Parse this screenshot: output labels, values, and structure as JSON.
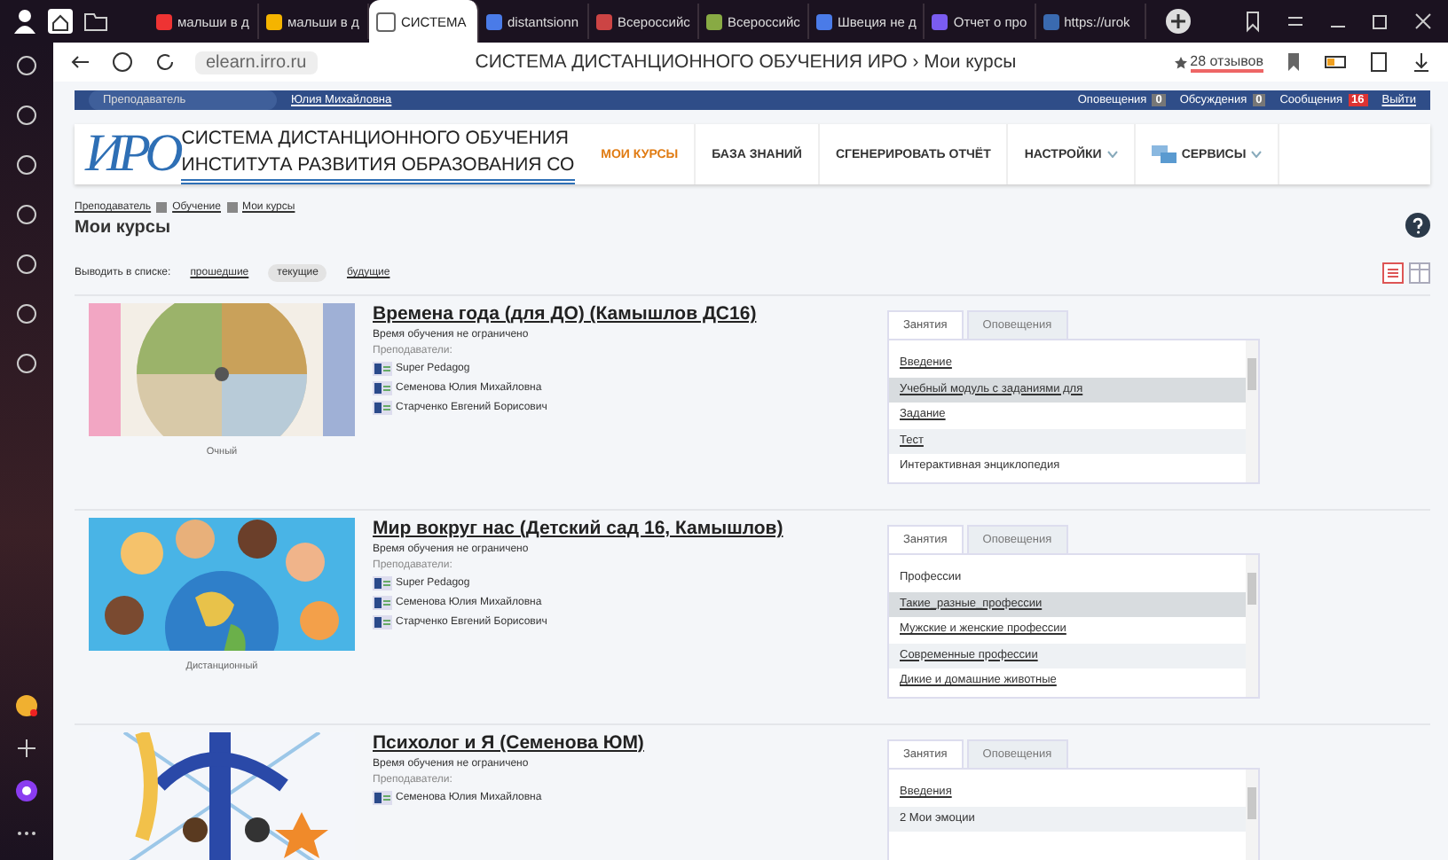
{
  "browser": {
    "tabs": [
      {
        "title": "мальши в д",
        "selected": false
      },
      {
        "title": "мальши в д",
        "selected": false
      },
      {
        "title": "СИСТЕМА",
        "selected": true
      },
      {
        "title": "distantsionn",
        "selected": false
      },
      {
        "title": "Всероссийс",
        "selected": false
      },
      {
        "title": "Всероссийс",
        "selected": false
      },
      {
        "title": "Швеция не д",
        "selected": false
      },
      {
        "title": "Отчет о про",
        "selected": false
      },
      {
        "title": "https://urok",
        "selected": false
      }
    ],
    "address": "elearn.irro.ru",
    "page_title": "СИСТЕМА ДИСТАНЦИОННОГО ОБУЧЕНИЯ ИРО › Мои курсы",
    "reviews": "28 отзывов"
  },
  "user_bar": {
    "role": "Преподаватель",
    "user": "Юлия Михайловна",
    "counters": [
      {
        "label": "Оповещения",
        "count": "0",
        "alert": false
      },
      {
        "label": "Обсуждения",
        "count": "0",
        "alert": false
      },
      {
        "label": "Сообщения",
        "count": "16",
        "alert": true
      }
    ],
    "logout": "Выйти"
  },
  "header": {
    "logo_mark": "ИРО",
    "logo_lines": [
      "СИСТЕМА ДИСТАНЦИОННОГО ОБУЧЕНИЯ",
      "ИНСТИТУТА РАЗВИТИЯ ОБРАЗОВАНИЯ СО"
    ],
    "nav": [
      {
        "label": "МОИ КУРСЫ",
        "selected": true,
        "dropdown": false
      },
      {
        "label": "БАЗА ЗНАНИЙ",
        "selected": false,
        "dropdown": false
      },
      {
        "label": "СГЕНЕРИРОВАТЬ ОТЧЁТ",
        "selected": false,
        "dropdown": false
      },
      {
        "label": "НАСТРОЙКИ",
        "selected": false,
        "dropdown": true
      },
      {
        "label": "СЕРВИСЫ",
        "selected": false,
        "dropdown": true
      }
    ]
  },
  "breadcrumbs": [
    "Преподаватель",
    "Обучение",
    "Мои курсы"
  ],
  "heading": "Мои курсы",
  "filter": {
    "label": "Выводить в списке:",
    "options": [
      {
        "label": "прошедшие",
        "selected": false
      },
      {
        "label": "текущие",
        "selected": true
      },
      {
        "label": "будущие",
        "selected": false
      }
    ]
  },
  "courses": [
    {
      "title": "Времена года (для ДО) (Камышлов ДС16)",
      "duration": "Время обучения не ограничено",
      "teachers_label": "Преподаватели:",
      "teachers": [
        "Super Pedagog",
        "Семенова Юлия Михайловна",
        "Старченко Евгений Борисович"
      ],
      "form": "Очный",
      "tabs": [
        {
          "label": "Занятия",
          "selected": true
        },
        {
          "label": "Оповещения",
          "selected": false
        }
      ],
      "lessons": [
        {
          "title": "Введение",
          "link": true,
          "selected": false
        },
        {
          "title": "Учебный модуль с заданиями для",
          "link": true,
          "selected": true
        },
        {
          "title": "Задание",
          "link": true,
          "selected": false
        },
        {
          "title": "Тест",
          "link": true,
          "selected": false
        },
        {
          "title": "Интерактивная энциклопедия",
          "link": false,
          "selected": false
        }
      ]
    },
    {
      "title": "Мир вокруг нас (Детский сад 16, Камышлов)",
      "duration": "Время обучения не ограничено",
      "teachers_label": "Преподаватели:",
      "teachers": [
        "Super Pedagog",
        "Семенова Юлия Михайловна",
        "Старченко Евгений Борисович"
      ],
      "form": "Дистанционный",
      "tabs": [
        {
          "label": "Занятия",
          "selected": true
        },
        {
          "label": "Оповещения",
          "selected": false
        }
      ],
      "lessons": [
        {
          "title": "Профессии",
          "link": false,
          "selected": false
        },
        {
          "title": "Такие_разные_профессии",
          "link": true,
          "selected": true
        },
        {
          "title": "Мужские и женские профессии",
          "link": true,
          "selected": false
        },
        {
          "title": "Современные профессии",
          "link": true,
          "selected": false
        },
        {
          "title": "Дикие и домашние животные",
          "link": true,
          "selected": false
        }
      ]
    },
    {
      "title": "Психолог и Я (Семенова ЮМ)",
      "duration": "Время обучения не ограничено",
      "teachers_label": "Преподаватели:",
      "teachers": [
        "Семенова Юлия Михайловна"
      ],
      "tabs": [
        {
          "label": "Занятия",
          "selected": true
        },
        {
          "label": "Оповещения",
          "selected": false
        }
      ],
      "lessons": [
        {
          "title": "Введения",
          "link": true,
          "selected": false
        },
        {
          "title": "2 Мои эмоции",
          "link": false,
          "selected": false
        }
      ]
    }
  ]
}
